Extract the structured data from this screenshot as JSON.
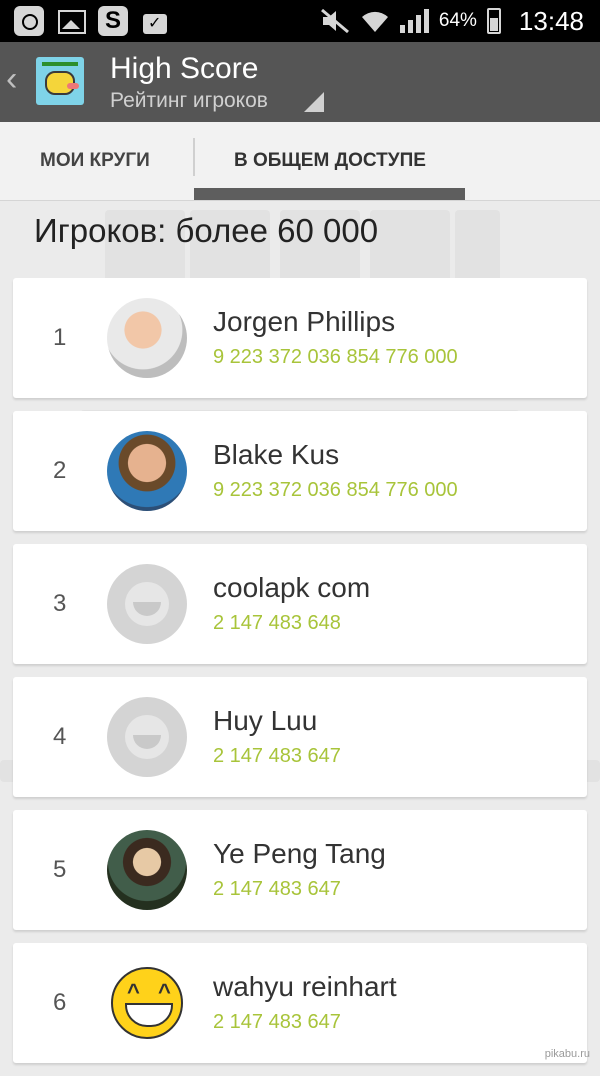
{
  "status_bar": {
    "left_icons": [
      "instagram-icon",
      "gallery-icon",
      "s-app-icon",
      "shopping-bag-icon"
    ],
    "right_icons": [
      "mute-icon",
      "wifi-icon",
      "signal-icon",
      "battery-icon"
    ],
    "battery_percent": "64%",
    "time": "13:48"
  },
  "action_bar": {
    "back_icon": "chevron-left-icon",
    "app_icon": "flappy-bird-icon",
    "title": "High Score",
    "subtitle": "Рейтинг игроков"
  },
  "tabs": [
    {
      "label": "МОИ КРУГИ",
      "selected": false
    },
    {
      "label": "В ОБЩЕМ ДОСТУПЕ",
      "selected": true
    }
  ],
  "players_count": "Игроков: более 60 000",
  "leaderboard": [
    {
      "rank": "1",
      "name": "Jorgen Phillips",
      "score": "9 223 372 036 854 776 000",
      "avatar": "photo"
    },
    {
      "rank": "2",
      "name": "Blake Kus",
      "score": "9 223 372 036 854 776 000",
      "avatar": "photo"
    },
    {
      "rank": "3",
      "name": "coolapk com",
      "score": "2 147 483 648",
      "avatar": "default-avatar"
    },
    {
      "rank": "4",
      "name": "Huy Luu",
      "score": "2 147 483 647",
      "avatar": "default-avatar"
    },
    {
      "rank": "5",
      "name": "Ye Peng Tang",
      "score": "2 147 483 647",
      "avatar": "photo"
    },
    {
      "rank": "6",
      "name": "wahyu reinhart",
      "score": "2 147 483 647",
      "avatar": "smiley"
    }
  ],
  "colors": {
    "score": "#a8c43a",
    "action_bar": "#555555",
    "tab_indicator": "#5e5e5e",
    "background": "#ebebeb"
  },
  "watermark": "pikabu.ru"
}
